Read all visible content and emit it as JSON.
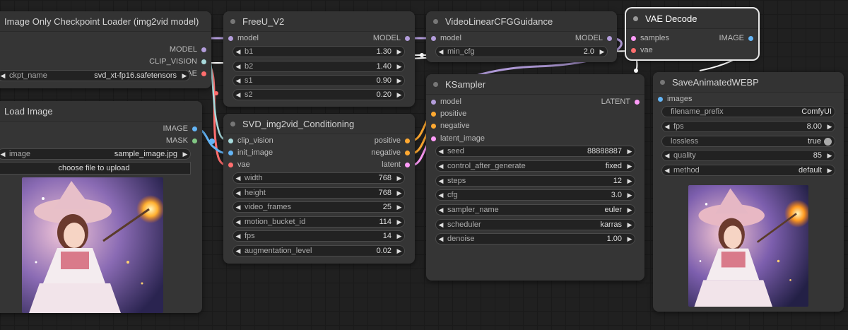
{
  "colors": {
    "model": "#b39ddb",
    "clip_vision": "#a8dadc",
    "vae": "#ff6e6e",
    "image": "#64b5f6",
    "mask": "#81c784",
    "positive": "#ffa931",
    "latent": "#ff9cf9"
  },
  "checkpoint_loader": {
    "title": "Image Only Checkpoint Loader (img2vid model)",
    "outputs": [
      "MODEL",
      "CLIP_VISION",
      "VAE"
    ],
    "ckpt_label": "ckpt_name",
    "ckpt_value": "svd_xt-fp16.safetensors"
  },
  "load_image": {
    "title": "Load Image",
    "outputs": [
      "IMAGE",
      "MASK"
    ],
    "image_label": "image",
    "image_value": "sample_image.jpg",
    "upload_label": "choose file to upload"
  },
  "freeu": {
    "title": "FreeU_V2",
    "input": "model",
    "output": "MODEL",
    "widgets": [
      {
        "label": "b1",
        "value": "1.30"
      },
      {
        "label": "b2",
        "value": "1.40"
      },
      {
        "label": "s1",
        "value": "0.90"
      },
      {
        "label": "s2",
        "value": "0.20"
      }
    ]
  },
  "conditioning": {
    "title": "SVD_img2vid_Conditioning",
    "inputs": [
      "clip_vision",
      "init_image",
      "vae"
    ],
    "outputs": [
      "positive",
      "negative",
      "latent"
    ],
    "widgets": [
      {
        "label": "width",
        "value": "768"
      },
      {
        "label": "height",
        "value": "768"
      },
      {
        "label": "video_frames",
        "value": "25"
      },
      {
        "label": "motion_bucket_id",
        "value": "114"
      },
      {
        "label": "fps",
        "value": "14"
      },
      {
        "label": "augmentation_level",
        "value": "0.02"
      }
    ]
  },
  "cfg_guidance": {
    "title": "VideoLinearCFGGuidance",
    "input": "model",
    "output": "MODEL",
    "widget_label": "min_cfg",
    "widget_value": "2.0"
  },
  "ksampler": {
    "title": "KSampler",
    "inputs": [
      "model",
      "positive",
      "negative",
      "latent_image"
    ],
    "output": "LATENT",
    "widgets": [
      {
        "label": "seed",
        "value": "88888887"
      },
      {
        "label": "control_after_generate",
        "value": "fixed"
      },
      {
        "label": "steps",
        "value": "12"
      },
      {
        "label": "cfg",
        "value": "3.0"
      },
      {
        "label": "sampler_name",
        "value": "euler"
      },
      {
        "label": "scheduler",
        "value": "karras"
      },
      {
        "label": "denoise",
        "value": "1.00"
      }
    ]
  },
  "vae_decode": {
    "title": "VAE Decode",
    "inputs": [
      "samples",
      "vae"
    ],
    "output": "IMAGE"
  },
  "save_webp": {
    "title": "SaveAnimatedWEBP",
    "input": "images",
    "filename_label": "filename_prefix",
    "filename_value": "ComfyUI",
    "widgets": [
      {
        "label": "fps",
        "value": "8.00"
      },
      {
        "label": "lossless",
        "value": "true"
      },
      {
        "label": "quality",
        "value": "85"
      },
      {
        "label": "method",
        "value": "default"
      }
    ]
  }
}
